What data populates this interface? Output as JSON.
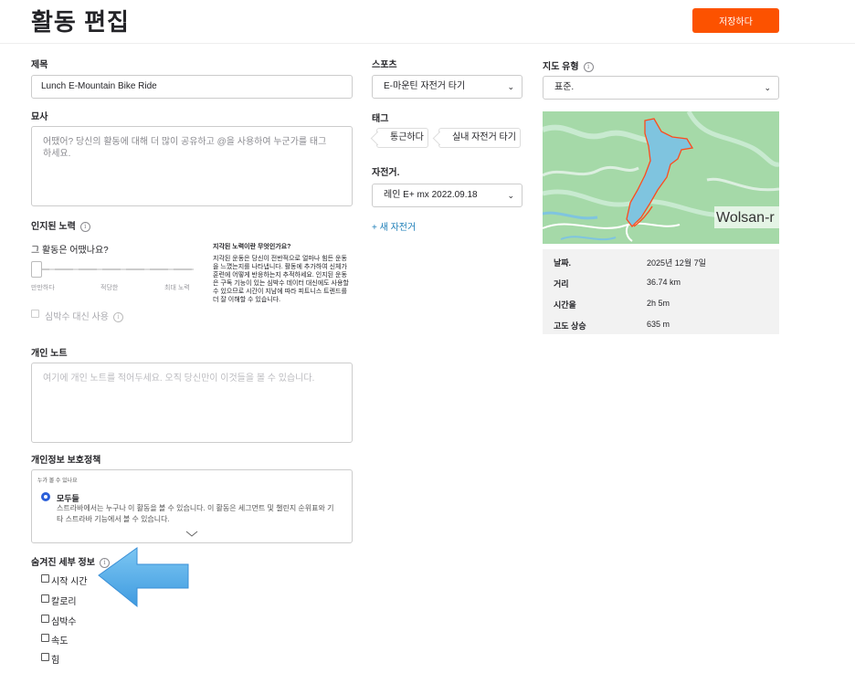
{
  "header": {
    "title": "활동 편집",
    "save_label": "저장하다"
  },
  "form": {
    "title_label": "제목",
    "title_value": "Lunch E-Mountain Bike Ride",
    "description_label": "묘사",
    "description_placeholder": "어땠어? 당신의 활동에 대해 더 많이 공유하고 @을 사용하여 누군가를 태그하세요.",
    "effort_label": "인지된 노력",
    "effort_question": "그 활동은 어땠나요?",
    "effort_ticks": [
      "만만하다",
      "적당한",
      "최대 노력"
    ],
    "effort_value": 0,
    "effort_help_title": "지각된 노력이란 무엇인가요?",
    "effort_help_body": "지각된 운동은 당신이 전반적으로 얼마나 힘든 운동을 느꼈는지를 나타냅니다. 활동에 추가하여 신체가 훈련에 어떻게 반응하는지 추적하세요. 인지된 운동은 구독 기능이 있는 심박수 데이터 대신에도 사용할 수 있으므로 시간이 지남에 따라 피트니스 트렌드를 더 잘 이해할 수 있습니다.",
    "hr_instead_label": "심박수 대신 사용",
    "private_notes_label": "개인 노트",
    "private_notes_placeholder": "여기에 개인 노트를 적어두세요. 오직 당신만이 이것들을 볼 수 있습니다.",
    "privacy_label": "개인정보 보호정책",
    "privacy_who": "누가 볼 수 있나요",
    "privacy_option_title": "모두들",
    "privacy_option_desc": "스트라바에서는 누구나 이 활동을 볼 수 있습니다. 이 활동은 세그먼트 및 챌린지 순위표와 기타 스트라바 기능에서 볼 수 있습니다.",
    "hidden_details_label": "숨겨진 세부 정보",
    "hidden_details": [
      "시작 시간",
      "칼로리",
      "심박수",
      "속도",
      "힘"
    ],
    "sport_label": "스포츠",
    "sport_value": "E-마운틴 자전거 타기",
    "tags_label": "태그",
    "tags": [
      "통근하다",
      "실내 자전거 타기"
    ],
    "bike_label": "자전거.",
    "bike_value": "레인 E+ mx 2022.09.18",
    "new_bike_link": "+ 새 자전거",
    "map_type_label": "지도 유형",
    "map_type_value": "표준.",
    "map_place_label": "Wolsan-r"
  },
  "stats": [
    {
      "label": "날짜.",
      "value": "2025년 12월 7일"
    },
    {
      "label": "거리",
      "value": "36.74 km"
    },
    {
      "label": "시간을",
      "value": "2h 5m"
    },
    {
      "label": "고도 상승",
      "value": "635 m"
    }
  ],
  "colors": {
    "accent": "#fc5200",
    "radio": "#2b5fd9",
    "arrow": "#5aaeea",
    "lake": "#7fc4df",
    "route": "#ff4a1c",
    "map_green": "#9fd9a6"
  },
  "icons": {
    "info": "info-icon",
    "arrow": "arrow-left-icon",
    "chevron": "chevron-down-icon"
  }
}
